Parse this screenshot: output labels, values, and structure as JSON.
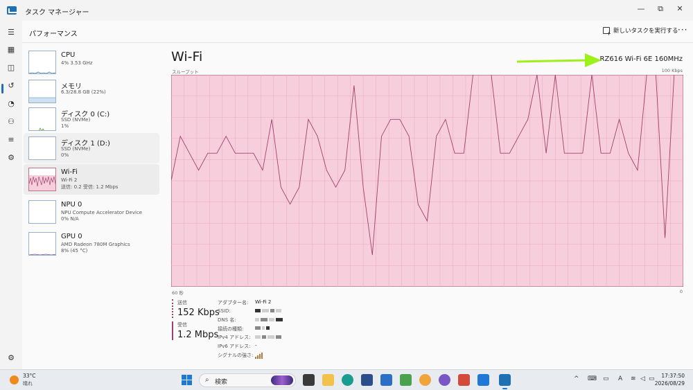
{
  "window": {
    "title": "タスク マネージャー",
    "minimize_glyph": "—",
    "maximize_glyph": "⧉",
    "close_glyph": "✕"
  },
  "header": {
    "title": "パフォーマンス",
    "run_task_label": "新しいタスクを実行する",
    "more_glyph": "···"
  },
  "rail": {
    "items": [
      "hamburger-icon",
      "processes-icon",
      "performance-icon",
      "app-history-icon",
      "startup-apps-icon",
      "users-icon",
      "details-icon",
      "services-icon",
      "settings-icon"
    ],
    "active": "performance-icon"
  },
  "devices": [
    {
      "name": "CPU",
      "sub1": "4%  3.53 GHz",
      "sub2": "",
      "graph_color": "#2f7fc1"
    },
    {
      "name": "メモリ",
      "sub1": "6.3/28.8 GB (22%)",
      "sub2": "",
      "graph_color": "#7fa8d0"
    },
    {
      "name": "ディスク 0 (C:)",
      "sub1": "SSD (NVMe)",
      "sub2": "1%",
      "graph_color": "#5a9a3a"
    },
    {
      "name": "ディスク 1 (D:)",
      "sub1": "SSD (NVMe)",
      "sub2": "0%",
      "graph_color": "#5a9a3a"
    },
    {
      "name": "Wi-Fi",
      "sub1": "Wi-Fi 2",
      "sub2": "送信: 0.2  受信: 1.2 Mbps",
      "graph_color": "#a0406a"
    },
    {
      "name": "NPU 0",
      "sub1": "NPU Compute Accelerator Device",
      "sub2": "0%  N/A",
      "graph_color": "#2f7fc1"
    },
    {
      "name": "GPU 0",
      "sub1": "AMD Radeon 780M Graphics",
      "sub2": "8% (45 °C)",
      "graph_color": "#6a4fa8"
    }
  ],
  "main": {
    "title": "Wi-Fi",
    "adapter": "RZ616 Wi-Fi 6E 160MHz",
    "throughput_label": "スループット",
    "max_label": "100 Kbps",
    "time_label": "60 秒",
    "zero_label": "0",
    "send_label": "送信",
    "send_value": "152 Kbps",
    "recv_label": "受信",
    "recv_value": "1.2 Mbps",
    "properties": [
      {
        "key": "アダプター名:",
        "value": "Wi-Fi 2"
      },
      {
        "key": "SSID:",
        "value": ""
      },
      {
        "key": "DNS 名:",
        "value": ""
      },
      {
        "key": "接続の種類:",
        "value": ""
      },
      {
        "key": "IPv4 アドレス:",
        "value": ""
      },
      {
        "key": "IPv6 アドレス:",
        "value": "-"
      },
      {
        "key": "シグナルの強さ:",
        "value": ""
      }
    ]
  },
  "chart_data": {
    "type": "line",
    "title": "",
    "xlabel": "",
    "ylabel": "スループット",
    "x_range_label": "60 秒",
    "ylim": [
      0,
      100
    ],
    "y_unit": "Kbps",
    "grid": true,
    "series": [
      {
        "name": "",
        "values": [
          50,
          71,
          63,
          55,
          63,
          63,
          71,
          63,
          63,
          63,
          55,
          79,
          47,
          39,
          47,
          79,
          71,
          55,
          47,
          55,
          95,
          47,
          15,
          71,
          79,
          79,
          71,
          39,
          31,
          71,
          79,
          63,
          63,
          100,
          100,
          100,
          63,
          63,
          71,
          79,
          100,
          63,
          100,
          63,
          63,
          63,
          100,
          63,
          63,
          79,
          63,
          55,
          100,
          100,
          23,
          100,
          100
        ]
      }
    ]
  },
  "taskbar": {
    "weather_temp": "33°C",
    "weather_desc": "晴れ",
    "search_placeholder": "検索",
    "time": "17:37:50",
    "date": "2026/08/29",
    "tray_chevron": "^",
    "ime": "A"
  },
  "colors": {
    "accent": "#1f6fb5",
    "chart_fill": "#f7cfdc",
    "chart_line": "#a0406a",
    "chart_grid": "#e8a8be",
    "arrow": "#9ef01a"
  }
}
